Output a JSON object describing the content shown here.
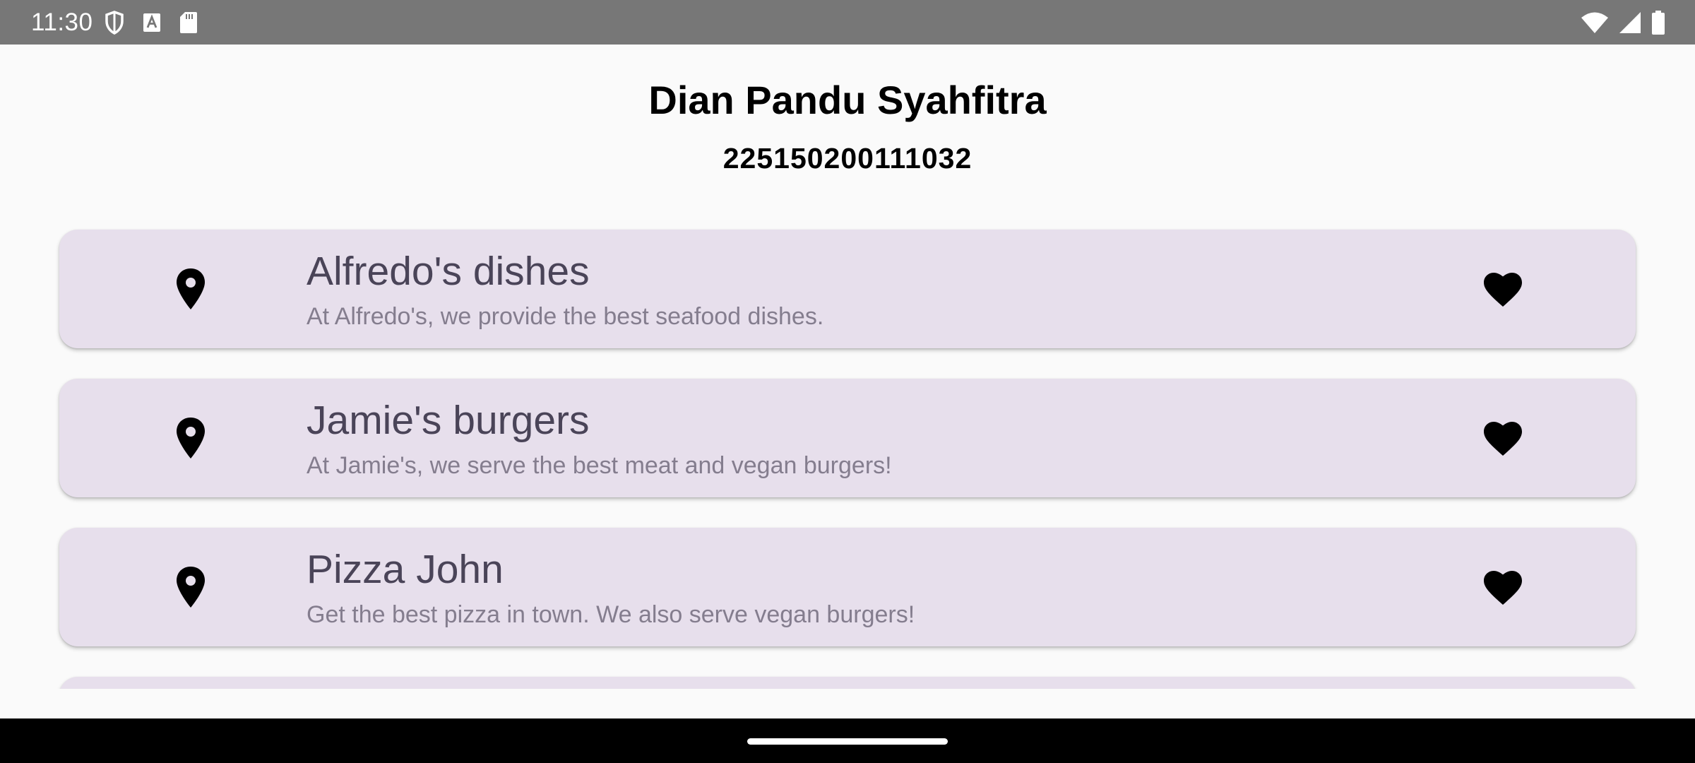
{
  "status_bar": {
    "time": "11:30",
    "left_icons": [
      "shield-icon",
      "keyboard-a-icon",
      "sd-card-icon"
    ],
    "right_icons": [
      "wifi-icon",
      "cellular-signal-icon",
      "battery-icon"
    ]
  },
  "header": {
    "name": "Dian Pandu Syahfitra",
    "student_id": "225150200111032"
  },
  "restaurants": [
    {
      "title": "Alfredo's dishes",
      "description": "At Alfredo's, we provide the best seafood dishes.",
      "leading_icon": "location-pin-icon",
      "trailing_icon": "heart-icon"
    },
    {
      "title": "Jamie's burgers",
      "description": "At Jamie's, we serve the best meat and vegan burgers!",
      "leading_icon": "location-pin-icon",
      "trailing_icon": "heart-icon"
    },
    {
      "title": "Pizza John",
      "description": "Get the best pizza in town. We also serve vegan burgers!",
      "leading_icon": "location-pin-icon",
      "trailing_icon": "heart-icon"
    }
  ],
  "colors": {
    "status_bar": "#777777",
    "background": "#fafafa",
    "card": "#e7dfec",
    "title_text": "#4a4458",
    "description_text": "#847d8e",
    "nav_bar": "#000000"
  }
}
